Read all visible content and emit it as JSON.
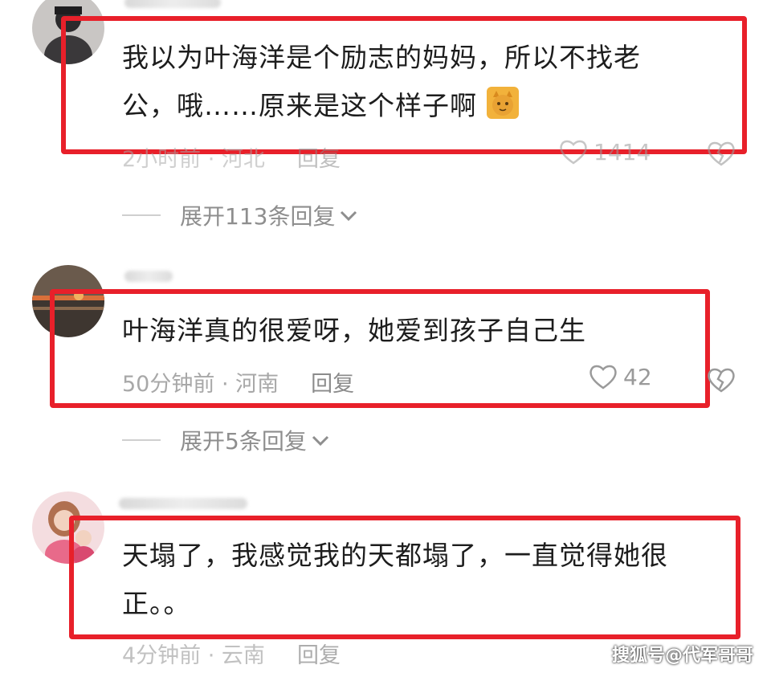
{
  "comments": [
    {
      "line1": "我以为叶海洋是个励志的妈妈，所以不找老",
      "line2": "公，哦……原来是这个样子啊",
      "time": "2小时前 · 河北",
      "reply": "回复",
      "likes": "1414",
      "expand": "展开113条回复"
    },
    {
      "line1": "叶海洋真的很爱呀，她爱到孩子自己生",
      "time": "50分钟前 · 河南",
      "reply": "回复",
      "likes": "42",
      "expand": "展开5条回复"
    },
    {
      "line1": "天塌了，我感觉我的天都塌了，一直觉得她很",
      "line2": "正。。",
      "time": "4分钟前 · 云南",
      "reply": "回复"
    }
  ],
  "watermark": "搜狐号@代军哥哥",
  "colors": {
    "highlight_box": "#e8202a",
    "meta_text": "#a8a8a8"
  }
}
